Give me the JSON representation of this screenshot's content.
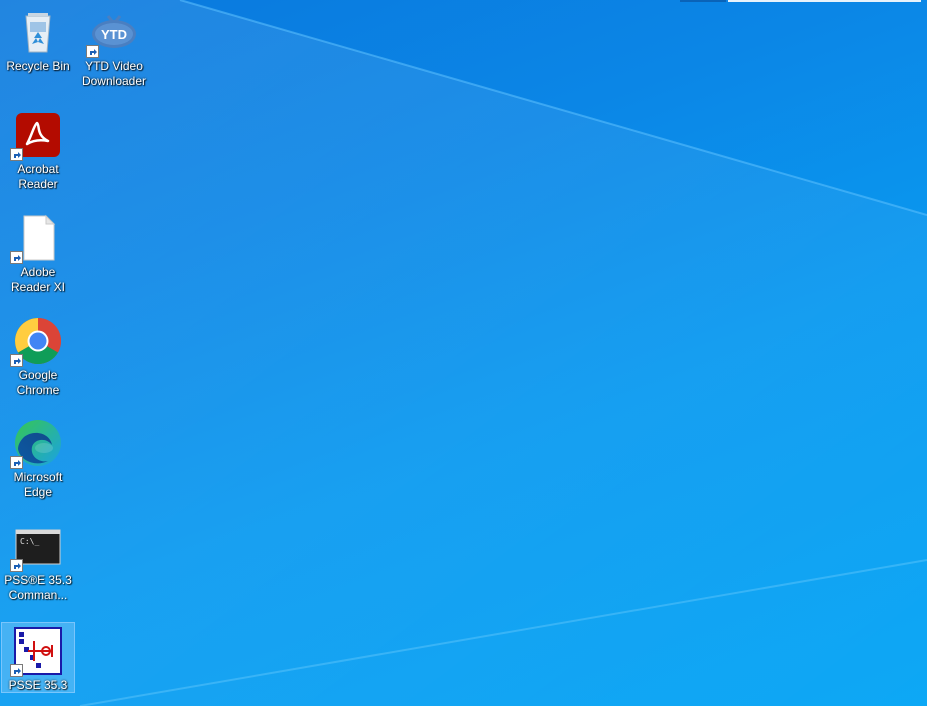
{
  "desktop": {
    "icons": [
      {
        "label": "Recycle Bin",
        "icon": "recycle-bin-icon"
      },
      {
        "label": "YTD Video\nDownloader",
        "icon": "ytd-icon"
      },
      {
        "label": "Acrobat\nReader",
        "icon": "acrobat-icon"
      },
      {
        "label": "Adobe\nReader XI",
        "icon": "blank-file-icon"
      },
      {
        "label": "Google\nChrome",
        "icon": "chrome-icon"
      },
      {
        "label": "Microsoft\nEdge",
        "icon": "edge-icon"
      },
      {
        "label": "PSS®E 35.3\nComman...",
        "icon": "command-prompt-icon"
      },
      {
        "label": "PSSE 35.3",
        "icon": "psse-icon"
      }
    ]
  },
  "colors": {
    "wallpaper": "#0a8fe9",
    "selection": "#cce8ff"
  }
}
